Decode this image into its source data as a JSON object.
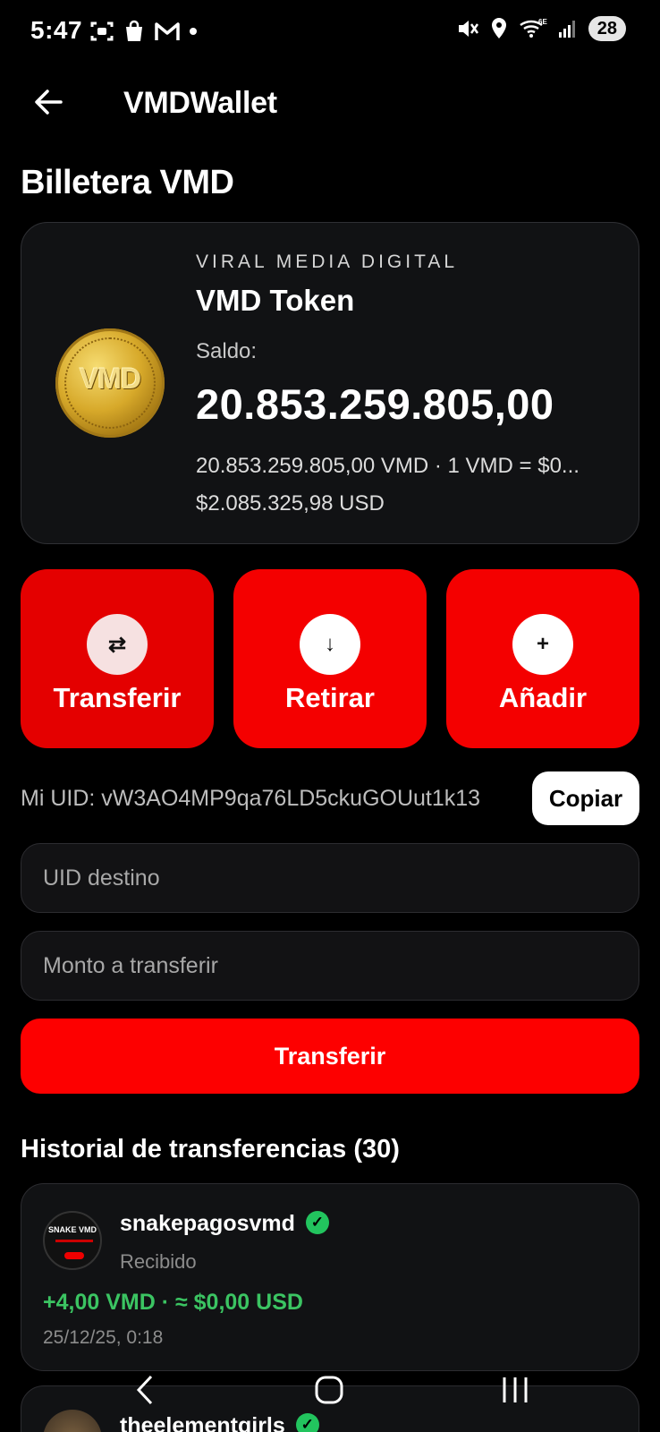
{
  "status_bar": {
    "time": "5:47",
    "battery": "28",
    "network": "6E",
    "icons_left": [
      "screenshot-icon",
      "shopping-bag-icon",
      "gmail-icon",
      "notification-dot"
    ],
    "icons_right": [
      "mute-icon",
      "location-icon",
      "wifi-icon",
      "signal-icon",
      "battery-icon"
    ]
  },
  "appbar": {
    "title": "VMDWallet",
    "back_icon": "arrow-left-icon"
  },
  "page": {
    "title": "Billetera VMD"
  },
  "wallet_card": {
    "coin_text": "VMD",
    "brand": "VIRAL MEDIA DIGITAL",
    "token_name": "VMD Token",
    "saldo_label": "Saldo:",
    "balance": "20.853.259.805,00",
    "detail": "20.853.259.805,00 VMD · 1 VMD = $0...",
    "usd": "$2.085.325,98 USD"
  },
  "actions": [
    {
      "label": "Transferir",
      "icon": "⇄",
      "icon_name": "transfer-icon"
    },
    {
      "label": "Retirar",
      "icon": "↓",
      "icon_name": "arrow-down-icon"
    },
    {
      "label": "Añadir",
      "icon": "+",
      "icon_name": "plus-icon"
    }
  ],
  "uid": {
    "text": "Mi UID: vW3AO4MP9qa76LD5ckuGOUut1k13",
    "copy_label": "Copiar"
  },
  "form": {
    "uid_placeholder": "UID destino",
    "amount_placeholder": "Monto a transferir",
    "submit_label": "Transferir"
  },
  "history": {
    "title": "Historial de transferencias (30)",
    "items": [
      {
        "name": "snakepagosvmd",
        "avatar_text": "SNAKE VMD",
        "type": "Recibido",
        "amount": "+4,00 VMD · ≈ $0,00 USD",
        "date": "25/12/25, 0:18",
        "verified": true
      },
      {
        "name": "theelementgirls",
        "verified": true
      }
    ]
  },
  "colors": {
    "accent": "#f40000",
    "background": "#000000",
    "card": "#111214",
    "positive": "#3bc462",
    "verified": "#22c45e"
  }
}
